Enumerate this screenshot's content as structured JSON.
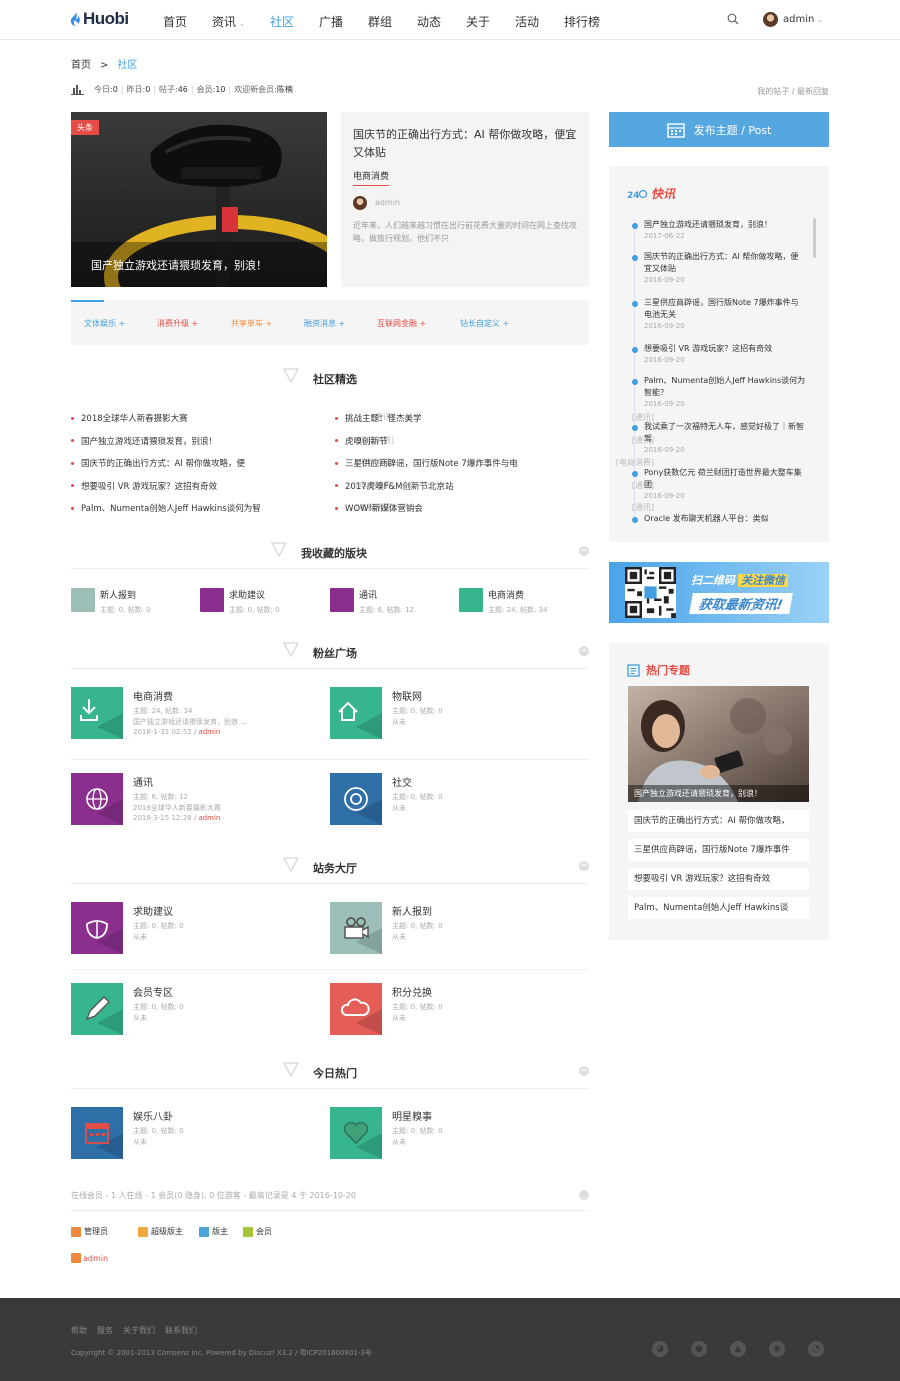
{
  "header": {
    "logo": "Huobi",
    "nav": [
      "首页",
      "资讯",
      "社区",
      "广播",
      "群组",
      "动态",
      "关于",
      "活动",
      "排行榜"
    ],
    "active_nav": "社区",
    "username": "admin"
  },
  "breadcrumb": {
    "home": "首页",
    "sep": ">",
    "current": "社区"
  },
  "stats": {
    "today_label": "今日:",
    "today": "0",
    "yesterday_label": "昨日:",
    "yesterday": "0",
    "posts_label": "帖子:",
    "posts": "46",
    "members_label": "会员:",
    "members": "10",
    "welcome_label": "欢迎新会员:",
    "welcome": "陈楠"
  },
  "stat_links": "我的帖子 / 最新回复",
  "hero": {
    "tag": "头条",
    "caption": "国产独立游戏还请猥琐发育，别浪！",
    "title": "国庆节的正确出行方式：AI 帮你做攻略，便宜又体贴",
    "category": "电商消费",
    "author": "admin",
    "excerpt": "近年来，人们越来越习惯在出行前花费大量的时间在网上查找攻略，做旅行规划。他们不只"
  },
  "tabs": [
    {
      "label": "文体娱乐 +",
      "color": "#3f9fe0"
    },
    {
      "label": "消费升级 +",
      "color": "#e44c45"
    },
    {
      "label": "共享单车 +",
      "color": "#f08a3e"
    },
    {
      "label": "融资消息 +",
      "color": "#3f9fe0"
    },
    {
      "label": "互联网金融 +",
      "color": "#e44c45"
    },
    {
      "label": "钻长自定义 +",
      "color": "#3f9fe0"
    }
  ],
  "sections": {
    "featured": "社区精选",
    "favorites": "我收藏的版块",
    "fans": "粉丝广场",
    "hall": "站务大厅",
    "hot_today": "今日热门"
  },
  "featured_left": [
    {
      "title": "2018全球华人新春摄影大赛",
      "cat": "[通讯]"
    },
    {
      "title": "国产独立游戏还请猥琐发育，别浪！",
      "cat": "[电商消费]"
    },
    {
      "title": "国庆节的正确出行方式：AI 帮你做攻略，便",
      "cat": "[电商消费]"
    },
    {
      "title": "想要吸引 VR 游戏玩家？这招有奇效",
      "cat": "[电商消费]"
    },
    {
      "title": "Palm、Numenta创始人Jeff Hawkins谈何为智",
      "cat": "[电商消费]"
    }
  ],
  "featured_right": [
    {
      "title": "挑战主题：怪杰美学",
      "cat": "[通讯]"
    },
    {
      "title": "虎嗅创新节",
      "cat": "[通讯]"
    },
    {
      "title": "三星供应商辟谣，国行版Note 7爆炸事件与电",
      "cat": "[电商消费]"
    },
    {
      "title": "2017虎嗅F&M创新节北京站",
      "cat": "[通讯]"
    },
    {
      "title": "WOW!新媒体营销会",
      "cat": "[通讯]"
    }
  ],
  "favorites": [
    {
      "name": "新人报到",
      "meta": "主题: 0, 帖数: 0",
      "color": "#9bbfb8"
    },
    {
      "name": "求助建议",
      "meta": "主题: 0, 帖数: 0",
      "color": "#8b2f8f"
    },
    {
      "name": "通讯",
      "meta": "主题: 6, 帖数: 12",
      "color": "#8b2f8f"
    },
    {
      "name": "电商消费",
      "meta": "主题: 24, 帖数: 34",
      "color": "#36b58f"
    }
  ],
  "fans": [
    {
      "name": "电商消费",
      "meta": "主题: 24, 帖数: 34",
      "last": "国产独立游戏还请猥琐发育，别浪 ...",
      "time": "2018-1-31 02:52",
      "by": "admin",
      "color": "#36b58f",
      "icon": "download-icon"
    },
    {
      "name": "物联网",
      "meta": "主题: 0, 帖数: 0",
      "last": "从未",
      "time": "",
      "by": "",
      "color": "#36b58f",
      "icon": "home-icon"
    },
    {
      "name": "通讯",
      "meta": "主题: 6, 帖数: 12",
      "last": "2018全球华人新春摄影大赛",
      "time": "2018-3-15 12:28",
      "by": "admin",
      "color": "#8b2f8f",
      "icon": "globe-icon"
    },
    {
      "name": "社交",
      "meta": "主题: 0, 帖数: 0",
      "last": "从未",
      "time": "",
      "by": "",
      "color": "#2f6fa8",
      "icon": "at-icon"
    }
  ],
  "hall": [
    {
      "name": "求助建议",
      "meta": "主题: 0, 帖数: 0",
      "last": "从未",
      "color": "#8b2f8f",
      "icon": "lotus-icon"
    },
    {
      "name": "新人报到",
      "meta": "主题: 0, 帖数: 0",
      "last": "从未",
      "color": "#9bbfb8",
      "icon": "camera-icon"
    },
    {
      "name": "会员专区",
      "meta": "主题: 0, 帖数: 0",
      "last": "从未",
      "color": "#36b58f",
      "icon": "pencil-icon"
    },
    {
      "name": "积分兑换",
      "meta": "主题: 0, 帖数: 0",
      "last": "从未",
      "color": "#e45d56",
      "icon": "cloud-icon"
    }
  ],
  "hot_today": [
    {
      "name": "娱乐八卦",
      "meta": "主题: 0, 帖数: 0",
      "last": "从未",
      "color": "#2f6fa8",
      "icon": "calendar-icon"
    },
    {
      "name": "明星糗事",
      "meta": "主题: 0, 帖数: 0",
      "last": "从未",
      "color": "#36b58f",
      "icon": "heart-icon"
    }
  ],
  "online": "在线会员 - 1 人在线 - 1 会员(0 隐身), 0 位游客 - 最高记录是 4 于 2016-10-20",
  "legend": [
    {
      "label": "管理员",
      "color": "#f08a3e"
    },
    {
      "label": "超级版主",
      "color": "#f0a93e"
    },
    {
      "label": "版主",
      "color": "#4aa3d8"
    },
    {
      "label": "会员",
      "color": "#a6c43a"
    }
  ],
  "online_user": "admin",
  "right": {
    "post_button": "发布主题 / Post",
    "flash_title": "快讯",
    "flash": [
      {
        "t": "国产独立游戏还请猥琐发育，别浪！",
        "d": "2017-06-22"
      },
      {
        "t": "国庆节的正确出行方式：AI 帮你做攻略，便宜又体贴",
        "d": "2016-09-20"
      },
      {
        "t": "三星供应商辟谣，国行版Note 7爆炸事件与电池无关",
        "d": "2016-09-20"
      },
      {
        "t": "想要吸引 VR 游戏玩家？这招有奇效",
        "d": "2016-09-20"
      },
      {
        "t": "Palm、Numenta创始人Jeff Hawkins谈何为智能？",
        "d": "2016-09-20"
      },
      {
        "t": "我试乘了一次福特无人车，感觉好极了｜新智驾",
        "d": "2016-09-20"
      },
      {
        "t": "Pony获数亿元 荷兰财团打造世界最大整车集团",
        "d": "2016-09-20"
      },
      {
        "t": "Oracle 发布聊天机器人平台：类似",
        "d": ""
      }
    ],
    "qr_line1": "扫二维码",
    "qr_tag": "关注微信",
    "qr_line2": "获取最新资讯!",
    "hot_title": "热门专题",
    "hot_caption": "国产独立游戏还请猥琐发育，别浪！",
    "hot_list": [
      "国庆节的正确出行方式：AI 帮你做攻略，",
      "三星供应商辟谣，国行版Note 7爆炸事件",
      "想要吸引 VR 游戏玩家？这招有奇效",
      "Palm、Numenta创始人Jeff Hawkins谈"
    ]
  },
  "footer": {
    "links": [
      "帮助",
      "服务",
      "关于我们",
      "联系我们"
    ],
    "copyright": "Copyright © 2001-2013 Comsenz Inc. Powered by Discuz! X3.2 / 粤ICP201600801-3号"
  }
}
